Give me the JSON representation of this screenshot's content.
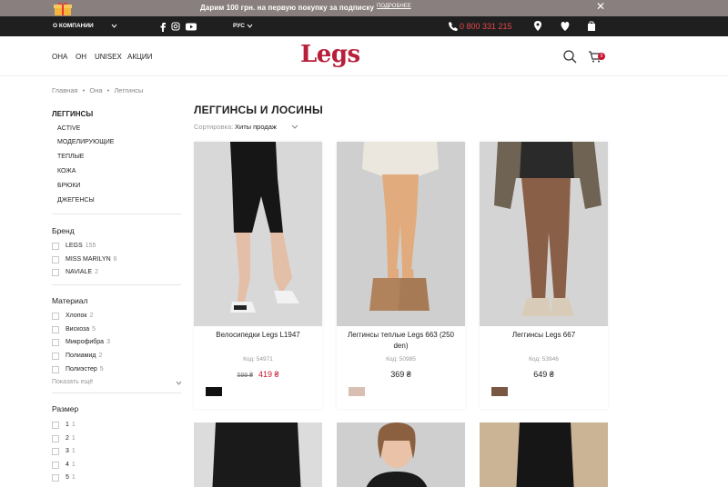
{
  "promo": {
    "message": "Дарим 100 грн. на первую покупку за подписку",
    "more": "ПОДРОБНЕЕ",
    "close": "✕"
  },
  "topbar": {
    "company": "О КОМПАНИИ",
    "lang": "РУС",
    "phone": "0 800 331 215"
  },
  "nav": {
    "items": [
      "ОНА",
      "ОН",
      "UNISEX",
      "АКЦИИ"
    ]
  },
  "logo": "Legs",
  "cart_count": "0",
  "breadcrumbs": [
    "Главная",
    "•",
    "Она",
    "•",
    "Леггинсы"
  ],
  "sidebar": {
    "categories_title": "ЛЕГГИНСЫ",
    "categories": [
      "ACTIVE",
      "МОДЕЛИРУЮЩИЕ",
      "ТЕПЛЫЕ",
      "КОЖА",
      "БРЮКИ",
      "ДЖЕГЕНСЫ"
    ],
    "brand": {
      "title": "Бренд",
      "options": [
        {
          "label": "LEGS",
          "count": "155"
        },
        {
          "label": "MISS MARILYN",
          "count": "6"
        },
        {
          "label": "NAVIALE",
          "count": "2"
        }
      ]
    },
    "material": {
      "title": "Материал",
      "options": [
        {
          "label": "Хлопок",
          "count": "2"
        },
        {
          "label": "Вискоза",
          "count": "5"
        },
        {
          "label": "Микрофибра",
          "count": "3"
        },
        {
          "label": "Полиамид",
          "count": "2"
        },
        {
          "label": "Полиэстер",
          "count": "5"
        }
      ],
      "show_more": "Показать ещё"
    },
    "size": {
      "title": "Размер",
      "options": [
        {
          "label": "1",
          "count": "1"
        },
        {
          "label": "2",
          "count": "1"
        },
        {
          "label": "3",
          "count": "1"
        },
        {
          "label": "4",
          "count": "1"
        },
        {
          "label": "5",
          "count": "1"
        }
      ]
    }
  },
  "main": {
    "title": "ЛЕГГИНСЫ И ЛОСИНЫ",
    "sort_label": "Сортировка:",
    "sort_value": "Хиты продаж"
  },
  "products": [
    {
      "name": "Велосипедки Legs L1947",
      "code": "Код: 54971",
      "old_price": "599 ₴",
      "price": "419 ₴",
      "swatch": "#111111",
      "photo_bg": "#d9d9d9",
      "garment": "#151515",
      "skin": "#e0b9a3"
    },
    {
      "name": "Леггинсы теплые Legs 663 (250 den)",
      "code": "Код: 50985",
      "old_price": "",
      "price": "369 ₴",
      "swatch": "#d9bfb3",
      "photo_bg": "#cfcfcf",
      "garment": "#e3ad7f",
      "skin": "#e3ad7f"
    },
    {
      "name": "Леггинсы Legs 667",
      "code": "Код: 53946",
      "old_price": "",
      "price": "649 ₴",
      "swatch": "#7a5742",
      "photo_bg": "#d2d2d2",
      "garment": "#8a5f48",
      "skin": "#ccc"
    }
  ]
}
